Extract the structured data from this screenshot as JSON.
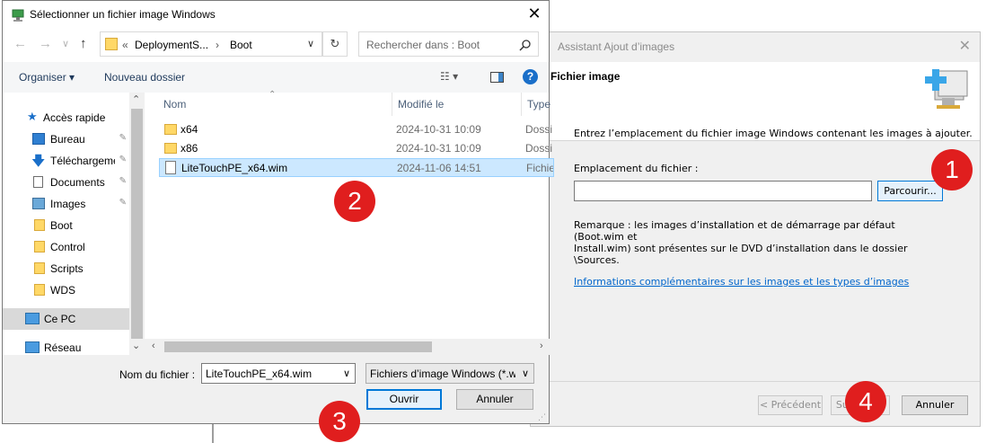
{
  "wizard": {
    "title": "Assistant Ajout d’images",
    "close_glyph": "✕",
    "header_title": "Fichier image",
    "header_icon": "add-image-icon",
    "instruction": "Entrez l’emplacement du fichier image Windows contenant les images à ajouter.",
    "location_label": "Emplacement du fichier :",
    "location_value": "",
    "browse_label": "Parcourir...",
    "note_line1": "Remarque : les images d’installation et de démarrage par défaut (Boot.wim et",
    "note_line2": "Install.wim) sont présentes sur le DVD d’installation dans le dossier \\Sources.",
    "link": "Informations complémentaires sur les images et les types d’images",
    "prev_label": "< Précédent",
    "next_label": "Suivant >",
    "cancel_label": "Annuler"
  },
  "dialog": {
    "title": "Sélectionner un fichier image Windows",
    "close_glyph": "✕",
    "nav": {
      "back": "←",
      "forward": "→",
      "recent": "∨",
      "up": "↑"
    },
    "address": {
      "overflow": "«",
      "crumb1": "DeploymentS...",
      "sep": "›",
      "crumb2": "Boot",
      "dropdown": "∨",
      "refresh": "↻"
    },
    "search_placeholder": "Rechercher dans : Boot",
    "toolbar": {
      "organize": "Organiser ▾",
      "new_folder": "Nouveau dossier",
      "view": "☷ ▾",
      "help": "?"
    },
    "navpane": [
      {
        "label": "Accès rapide",
        "icon": "star-icon",
        "pinned": false
      },
      {
        "label": "Bureau",
        "icon": "desktop-icon",
        "pinned": true
      },
      {
        "label": "Téléchargements",
        "icon": "download-icon",
        "pinned": true
      },
      {
        "label": "Documents",
        "icon": "documents-icon",
        "pinned": true
      },
      {
        "label": "Images",
        "icon": "pictures-icon",
        "pinned": true
      },
      {
        "label": "Boot",
        "icon": "folder-icon",
        "pinned": false
      },
      {
        "label": "Control",
        "icon": "folder-icon",
        "pinned": false
      },
      {
        "label": "Scripts",
        "icon": "folder-icon",
        "pinned": false
      },
      {
        "label": "WDS",
        "icon": "folder-icon",
        "pinned": false
      },
      {
        "label": "Ce PC",
        "icon": "computer-icon",
        "pinned": false
      },
      {
        "label": "Réseau",
        "icon": "network-icon",
        "pinned": false
      }
    ],
    "columns": {
      "name": "Nom",
      "modified": "Modifié le",
      "type": "Type"
    },
    "files": [
      {
        "name": "x64",
        "date": "2024-10-31 10:09",
        "type": "Dossier de fichiers",
        "kind": "folder"
      },
      {
        "name": "x86",
        "date": "2024-10-31 10:09",
        "type": "Dossier de fichiers",
        "kind": "folder"
      },
      {
        "name": "LiteTouchPE_x64.wim",
        "date": "2024-11-06 14:51",
        "type": "Fichier WIM",
        "kind": "file"
      }
    ],
    "filename_label": "Nom du fichier :",
    "filename_value": "LiteTouchPE_x64.wim",
    "filetype_value": "Fichiers d’image Windows (*.wim)",
    "open_label": "Ouvrir",
    "cancel_label": "Annuler",
    "pin_glyph": "📌"
  },
  "badges": [
    "1",
    "2",
    "3",
    "4"
  ],
  "colors": {
    "badge": "#e01e1e",
    "accent": "#0078d7",
    "selection": "#cce8ff"
  }
}
